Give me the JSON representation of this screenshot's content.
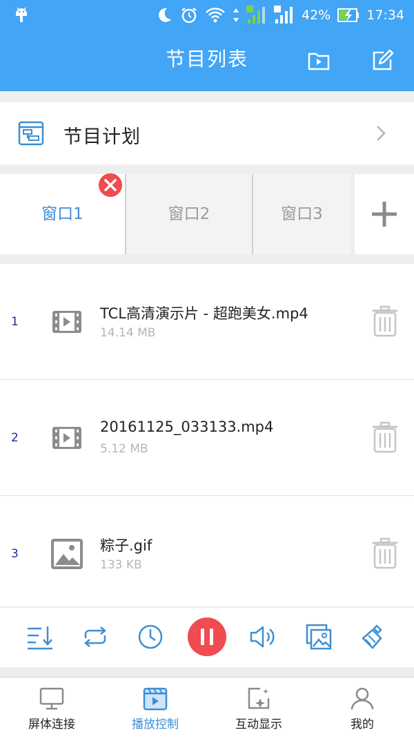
{
  "status_bar": {
    "battery": "42%",
    "time": "17:34"
  },
  "header": {
    "title": "节目列表"
  },
  "plan": {
    "label": "节目计划"
  },
  "tabs": [
    {
      "label": "窗口1",
      "active": true
    },
    {
      "label": "窗口2",
      "active": false
    },
    {
      "label": "窗口3",
      "active": false
    }
  ],
  "files": [
    {
      "index": "1",
      "name": "TCL高清演示片 - 超跑美女.mp4",
      "size": "14.14 MB",
      "icon": "video-icon"
    },
    {
      "index": "2",
      "name": "20161125_033133.mp4",
      "size": "5.12 MB",
      "icon": "video-icon"
    },
    {
      "index": "3",
      "name": "粽子.gif",
      "size": "133 KB",
      "icon": "image-icon"
    }
  ],
  "nav": [
    {
      "label": "屏体连接",
      "icon": "monitor-icon",
      "active": false
    },
    {
      "label": "播放控制",
      "icon": "play-control-icon",
      "active": true
    },
    {
      "label": "互动显示",
      "icon": "interactive-display-icon",
      "active": false
    },
    {
      "label": "我的",
      "icon": "user-icon",
      "active": false
    }
  ],
  "colors": {
    "primary": "#42a5f5",
    "accent": "#3d8ed6",
    "danger": "#ef4b50"
  }
}
